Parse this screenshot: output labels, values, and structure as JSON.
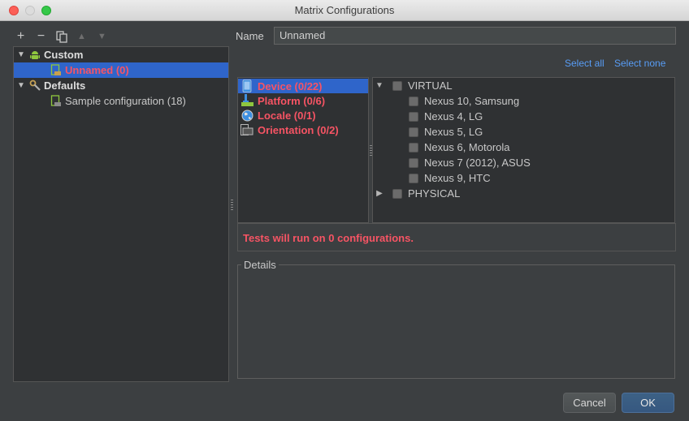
{
  "window": {
    "title": "Matrix Configurations"
  },
  "toolbar": {
    "add": "+",
    "remove": "−",
    "copy": "copy-icon",
    "up": "▲",
    "down": "▼"
  },
  "tree": {
    "custom_label": "Custom",
    "unnamed_label": "Unnamed (0)",
    "defaults_label": "Defaults",
    "sample_label": "Sample configuration (18)"
  },
  "name": {
    "label": "Name",
    "value": "Unnamed"
  },
  "links": {
    "select_all": "Select all",
    "select_none": "Select none"
  },
  "categories": [
    {
      "label": "Device (0/22)",
      "icon": "device-icon"
    },
    {
      "label": "Platform (0/6)",
      "icon": "platform-icon"
    },
    {
      "label": "Locale (0/1)",
      "icon": "globe-icon"
    },
    {
      "label": "Orientation (0/2)",
      "icon": "orientation-icon"
    }
  ],
  "devices": {
    "virtual_label": "VIRTUAL",
    "items": [
      "Nexus 10, Samsung",
      "Nexus 4, LG",
      "Nexus 5, LG",
      "Nexus 6, Motorola",
      "Nexus 7 (2012), ASUS",
      "Nexus 9, HTC"
    ],
    "physical_label": "PHYSICAL"
  },
  "status": {
    "prefix": "Tests will run on ",
    "count": "0",
    "suffix": " configurations."
  },
  "details": {
    "label": "Details"
  },
  "buttons": {
    "cancel": "Cancel",
    "ok": "OK"
  },
  "colors": {
    "accent": "#2f65ca",
    "error": "#f75464",
    "link": "#589df6"
  }
}
